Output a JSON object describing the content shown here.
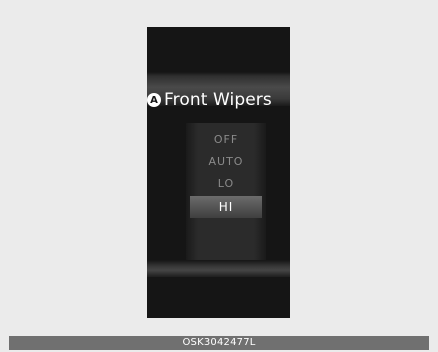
{
  "display": {
    "badge": "A",
    "title": "Front Wipers",
    "options": [
      {
        "label": "OFF"
      },
      {
        "label": "AUTO"
      },
      {
        "label": "LO"
      },
      {
        "label": "HI"
      }
    ],
    "selected_option": "HI"
  },
  "caption": "OSK3042477L",
  "colors": {
    "page_background": "#ebebeb",
    "screen_background": "#151515",
    "selected_highlight": "#555555",
    "caption_bar": "#707070"
  }
}
